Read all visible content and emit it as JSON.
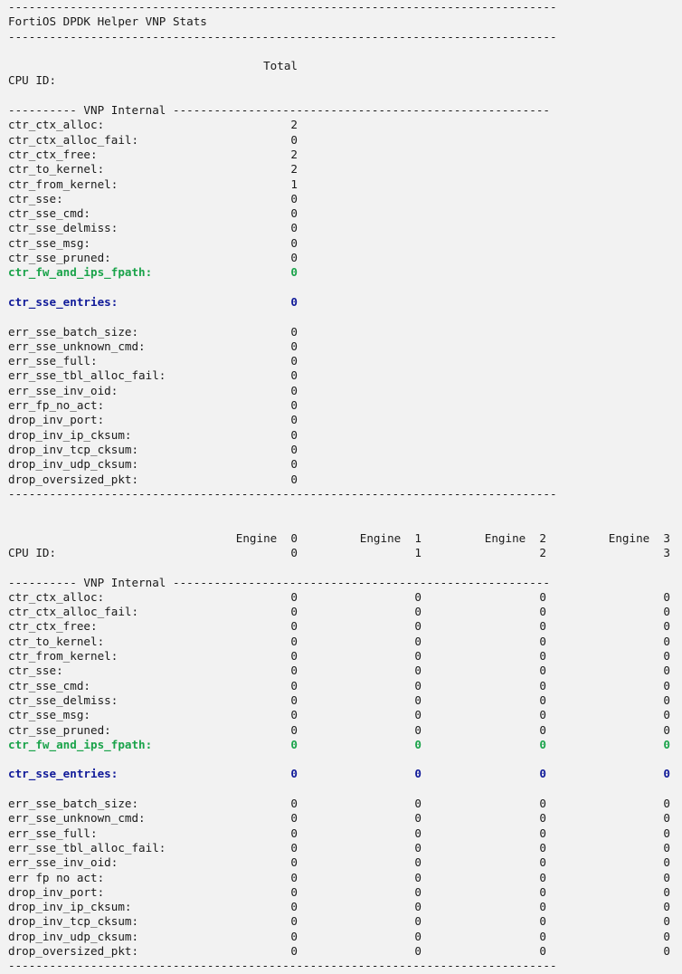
{
  "separator": "--------------------------------------------------------------------------------",
  "title": "FortiOS DPDK Helper VNP Stats",
  "section1": {
    "header": "Total",
    "cpu_label": "CPU ID:",
    "cpu_value": "",
    "subheader_left": "---------- VNP Internal ",
    "subheader_right": "-------------------------------------------------------",
    "rows_a": [
      {
        "label": "ctr_ctx_alloc:",
        "value": "2"
      },
      {
        "label": "ctr_ctx_alloc_fail:",
        "value": "0"
      },
      {
        "label": "ctr_ctx_free:",
        "value": "2"
      },
      {
        "label": "ctr_to_kernel:",
        "value": "2"
      },
      {
        "label": "ctr_from_kernel:",
        "value": "1"
      },
      {
        "label": "ctr_sse:",
        "value": "0"
      },
      {
        "label": "ctr_sse_cmd:",
        "value": "0"
      },
      {
        "label": "ctr_sse_delmiss:",
        "value": "0"
      },
      {
        "label": "ctr_sse_msg:",
        "value": "0"
      },
      {
        "label": "ctr_sse_pruned:",
        "value": "0"
      }
    ],
    "green_row": {
      "label": "ctr_fw_and_ips_fpath:",
      "value": "0"
    },
    "blue_row": {
      "label": "ctr_sse_entries:",
      "value": "0"
    },
    "rows_b": [
      {
        "label": "err_sse_batch_size:",
        "value": "0"
      },
      {
        "label": "err_sse_unknown_cmd:",
        "value": "0"
      },
      {
        "label": "err_sse_full:",
        "value": "0"
      },
      {
        "label": "err_sse_tbl_alloc_fail:",
        "value": "0"
      },
      {
        "label": "err_sse_inv_oid:",
        "value": "0"
      },
      {
        "label": "err_fp_no_act:",
        "value": "0"
      },
      {
        "label": "drop_inv_port:",
        "value": "0"
      },
      {
        "label": "drop_inv_ip_cksum:",
        "value": "0"
      },
      {
        "label": "drop_inv_tcp_cksum:",
        "value": "0"
      },
      {
        "label": "drop_inv_udp_cksum:",
        "value": "0"
      },
      {
        "label": "drop_oversized_pkt:",
        "value": "0"
      }
    ]
  },
  "section2": {
    "headers": [
      "Engine  0",
      "Engine  1",
      "Engine  2",
      "Engine  3"
    ],
    "cpu_label": "CPU ID:",
    "cpu_values": [
      "0",
      "1",
      "2",
      "3"
    ],
    "subheader_left": "---------- VNP Internal ",
    "subheader_right": "-------------------------------------------------------",
    "rows_a": [
      {
        "label": "ctr_ctx_alloc:",
        "values": [
          "0",
          "0",
          "0",
          "0"
        ]
      },
      {
        "label": "ctr_ctx_alloc_fail:",
        "values": [
          "0",
          "0",
          "0",
          "0"
        ]
      },
      {
        "label": "ctr_ctx_free:",
        "values": [
          "0",
          "0",
          "0",
          "0"
        ]
      },
      {
        "label": "ctr_to_kernel:",
        "values": [
          "0",
          "0",
          "0",
          "0"
        ]
      },
      {
        "label": "ctr_from_kernel:",
        "values": [
          "0",
          "0",
          "0",
          "0"
        ]
      },
      {
        "label": "ctr_sse:",
        "values": [
          "0",
          "0",
          "0",
          "0"
        ]
      },
      {
        "label": "ctr_sse_cmd:",
        "values": [
          "0",
          "0",
          "0",
          "0"
        ]
      },
      {
        "label": "ctr_sse_delmiss:",
        "values": [
          "0",
          "0",
          "0",
          "0"
        ]
      },
      {
        "label": "ctr_sse_msg:",
        "values": [
          "0",
          "0",
          "0",
          "0"
        ]
      },
      {
        "label": "ctr_sse_pruned:",
        "values": [
          "0",
          "0",
          "0",
          "0"
        ]
      }
    ],
    "green_row": {
      "label": "ctr_fw_and_ips_fpath:",
      "values": [
        "0",
        "0",
        "0",
        "0"
      ]
    },
    "blue_row": {
      "label": "ctr_sse_entries:",
      "values": [
        "0",
        "0",
        "0",
        "0"
      ]
    },
    "rows_b": [
      {
        "label": "err_sse_batch_size:",
        "values": [
          "0",
          "0",
          "0",
          "0"
        ]
      },
      {
        "label": "err_sse_unknown_cmd:",
        "values": [
          "0",
          "0",
          "0",
          "0"
        ]
      },
      {
        "label": "err_sse_full:",
        "values": [
          "0",
          "0",
          "0",
          "0"
        ]
      },
      {
        "label": "err_sse_tbl_alloc_fail:",
        "values": [
          "0",
          "0",
          "0",
          "0"
        ]
      },
      {
        "label": "err_sse_inv_oid:",
        "values": [
          "0",
          "0",
          "0",
          "0"
        ]
      },
      {
        "label": "err fp no act:",
        "values": [
          "0",
          "0",
          "0",
          "0"
        ]
      },
      {
        "label": "drop_inv_port:",
        "values": [
          "0",
          "0",
          "0",
          "0"
        ]
      },
      {
        "label": "drop_inv_ip_cksum:",
        "values": [
          "0",
          "0",
          "0",
          "0"
        ]
      },
      {
        "label": "drop_inv_tcp_cksum:",
        "values": [
          "0",
          "0",
          "0",
          "0"
        ]
      },
      {
        "label": "drop_inv_udp_cksum:",
        "values": [
          "0",
          "0",
          "0",
          "0"
        ]
      },
      {
        "label": "drop_oversized_pkt:",
        "values": [
          "0",
          "0",
          "0",
          "0"
        ]
      }
    ]
  },
  "colors": {
    "background": "#f2f2f2",
    "text": "#1a1a1a",
    "highlight_green": "#1aa34a",
    "highlight_blue": "#101a99"
  }
}
